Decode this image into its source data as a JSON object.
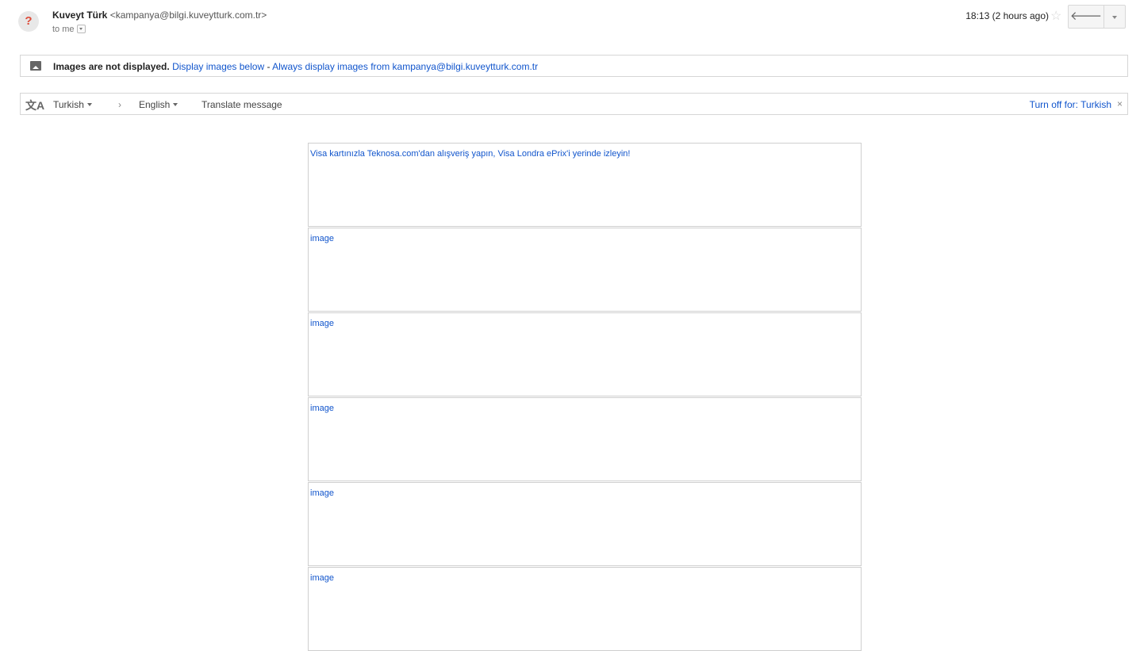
{
  "header": {
    "avatar_glyph": "?",
    "sender_name": "Kuveyt Türk",
    "sender_email": "<kampanya@bilgi.kuveytturk.com.tr>",
    "to_label": "to me",
    "time": "18:13 (2 hours ago)",
    "star_glyph": "☆",
    "reply_glyph": "🡐",
    "icons": [
      "star-icon",
      "reply-icon",
      "chevron-down-icon"
    ]
  },
  "images_bar": {
    "icon": "image-icon",
    "notice": "Images are not displayed.",
    "display_below": "Display images below",
    "separator": " - ",
    "always_display": "Always display images from kampanya@bilgi.kuveytturk.com.tr"
  },
  "translate_bar": {
    "icon": "translate-icon",
    "icon_glyph": "文A",
    "source_lang": "Turkish",
    "arrow": "›",
    "target_lang": "English",
    "translate_link": "Translate message",
    "turn_off": "Turn off for: Turkish",
    "close_glyph": "×"
  },
  "email_body": {
    "blocks": [
      "Visa kartınızla Teknosa.com'dan alışveriş yapın, Visa Londra ePrix'i yerinde izleyin!",
      "image",
      "image",
      "image",
      "image",
      "image"
    ]
  },
  "colors": {
    "link": "#1155cc",
    "avatar_mark": "#dd4b39",
    "border": "#d6d6d6"
  }
}
